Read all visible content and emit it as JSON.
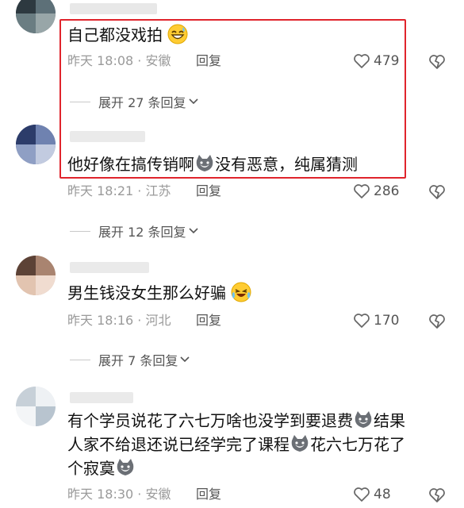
{
  "colors": {
    "highlight": "#e0242c",
    "text": "#111111",
    "meta": "#9a9a9a",
    "secondary": "#555555"
  },
  "icons": {
    "like": "heart-outline-icon",
    "dislike": "broken-heart-icon",
    "expand": "chevron-down-icon",
    "emoji_laugh": "grinning-sweat-emoji-icon",
    "emoji_cat": "cat-face-sticker-icon",
    "emoji_cry": "laughing-crying-emoji-icon"
  },
  "comments": [
    {
      "text": "自己都没戏拍",
      "time_location": "昨天 18:08 · 安徽",
      "reply_label": "回复",
      "likes": "479",
      "expand_label": "展开 27 条回复"
    },
    {
      "text_part1": "他好像在搞传销啊",
      "text_part2": "没有恶意，纯属猜测",
      "time_location": "昨天 18:21 · 江苏",
      "reply_label": "回复",
      "likes": "286",
      "expand_label": "展开 12 条回复"
    },
    {
      "text": "男生钱没女生那么好骗",
      "time_location": "昨天 18:16 · 河北",
      "reply_label": "回复",
      "likes": "170",
      "expand_label": "展开 7 条回复"
    },
    {
      "line1": "有个学员说花了六七万啥也没学到要退费",
      "line1_tail": "结果",
      "line2": "人家不给退还说已经学完了课程",
      "line2_tail": "花六七万花了",
      "line3": "个寂寞",
      "time_location": "昨天 18:30 · 安徽",
      "reply_label": "回复",
      "likes": "48"
    }
  ]
}
